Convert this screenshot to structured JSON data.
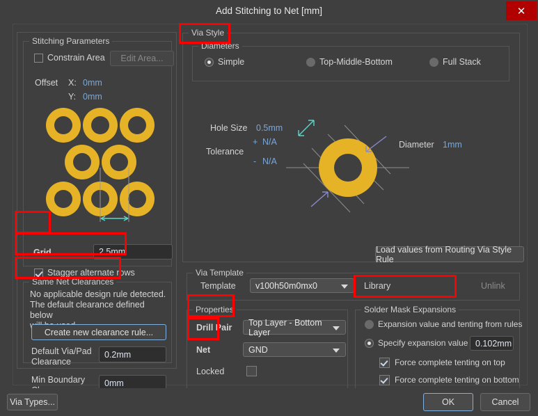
{
  "window": {
    "title": "Add Stitching to Net [mm]",
    "close_label": "✕"
  },
  "stitching_parameters": {
    "group_label": "Stitching Parameters",
    "constrain_area": {
      "label": "Constrain Area",
      "checked": false
    },
    "edit_area_button": {
      "label": "Edit Area...",
      "enabled": false
    },
    "offset": {
      "label": "Offset",
      "x_label": "X:",
      "x_value": "0mm",
      "y_label": "Y:",
      "y_value": "0mm"
    },
    "grid": {
      "label": "Grid",
      "value": "2.5mm"
    },
    "stagger": {
      "label": "Stagger alternate rows",
      "checked": true
    }
  },
  "same_net_clearances": {
    "group_label": "Same Net Clearances",
    "message_line1": "No applicable design rule detected.",
    "message_line2": "The default clearance defined below",
    "message_line3": "will be used.",
    "create_rule_button": "Create new clearance rule...",
    "default_clearance": {
      "label_line1": "Default Via/Pad",
      "label_line2": "Clearance",
      "value": "0.2mm"
    },
    "min_boundary": {
      "label_line1": "Min Boundary",
      "label_line2": "Clearance",
      "value": "0mm"
    }
  },
  "via_style": {
    "group_label": "Via Style",
    "diameters": {
      "group_label": "Diameters",
      "options": [
        {
          "label": "Simple",
          "selected": true
        },
        {
          "label": "Top-Middle-Bottom",
          "selected": false
        },
        {
          "label": "Full Stack",
          "selected": false
        }
      ]
    },
    "hole_size": {
      "label": "Hole Size",
      "value": "0.5mm"
    },
    "tolerance": {
      "label": "Tolerance",
      "plus_sign": "+",
      "plus_value": "N/A",
      "minus_sign": "-",
      "minus_value": "N/A"
    },
    "diameter": {
      "label": "Diameter",
      "value": "1mm"
    },
    "load_values_button": "Load values from Routing Via Style Rule"
  },
  "via_template": {
    "group_label": "Via Template",
    "template_label": "Template",
    "template_value": "v100h50m0mx0",
    "library_label": "Library",
    "unlink_label": "Unlink"
  },
  "properties": {
    "group_label": "Properties",
    "drill_pair": {
      "label": "Drill Pair",
      "value": "Top Layer - Bottom Layer"
    },
    "net": {
      "label": "Net",
      "value": "GND"
    },
    "locked": {
      "label": "Locked",
      "checked": false
    }
  },
  "solder_mask": {
    "group_label": "Solder Mask Expansions",
    "from_rules": {
      "label": "Expansion value and tenting from rules",
      "selected": false
    },
    "specify": {
      "label": "Specify expansion value",
      "selected": true,
      "value": "0.102mm"
    },
    "tent_top": {
      "label": "Force complete tenting on top",
      "checked": true
    },
    "tent_bottom": {
      "label": "Force complete tenting on bottom",
      "checked": true
    }
  },
  "footer": {
    "via_types_button": "Via Types...",
    "ok_button": "OK",
    "cancel_button": "Cancel"
  },
  "colors": {
    "via_copper": "#e6b327",
    "highlight": "#ff0000",
    "accent_blue": "#7aa7d8",
    "close_red": "#b00000",
    "dim_teal": "#5fd6c8",
    "arrow_violet": "#8a8ad0"
  }
}
